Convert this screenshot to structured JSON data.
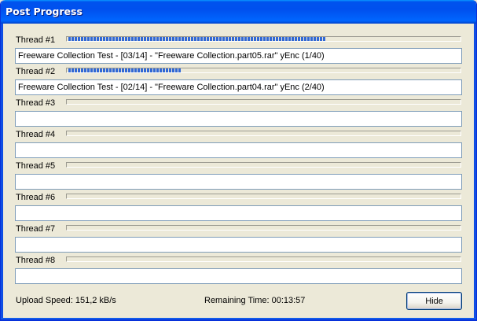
{
  "window": {
    "title": "Post Progress"
  },
  "threads": [
    {
      "label": "Thread #1",
      "progress": 0.66,
      "status": "Freeware Collection Test - [03/14] - \"Freeware Collection.part05.rar\" yEnc (1/40)"
    },
    {
      "label": "Thread #2",
      "progress": 0.29,
      "status": "Freeware Collection Test - [02/14] - \"Freeware Collection.part04.rar\" yEnc (2/40)"
    },
    {
      "label": "Thread #3",
      "progress": 0,
      "status": ""
    },
    {
      "label": "Thread #4",
      "progress": 0,
      "status": ""
    },
    {
      "label": "Thread #5",
      "progress": 0,
      "status": ""
    },
    {
      "label": "Thread #6",
      "progress": 0,
      "status": ""
    },
    {
      "label": "Thread #7",
      "progress": 0,
      "status": ""
    },
    {
      "label": "Thread #8",
      "progress": 0,
      "status": ""
    }
  ],
  "footer": {
    "upload_speed": "Upload Speed: 151,2 kB/s",
    "remaining_time": "Remaining Time: 00:13:57",
    "hide_label": "Hide"
  },
  "colors": {
    "titlebar": "#0053ee",
    "progress_fill": "#3168d5",
    "dialog_background": "#ece9d8"
  }
}
